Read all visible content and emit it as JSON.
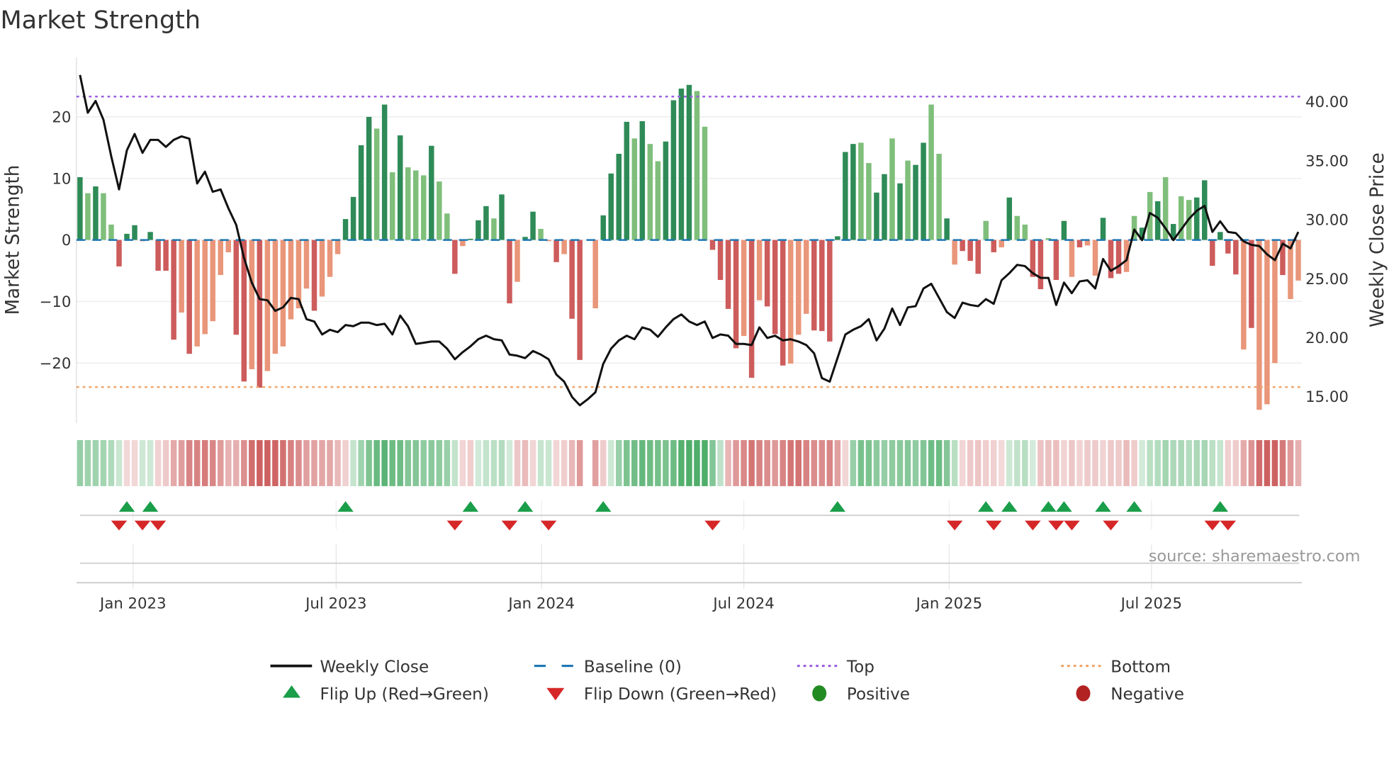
{
  "chart_data": {
    "type": "bar+line",
    "title": "Market Strength",
    "ylabel": "Market Strength",
    "y2label": "Weekly Close Price",
    "ylim": [
      -29,
      28
    ],
    "y2lim": [
      12.5,
      44.5
    ],
    "yticks": [
      20,
      10,
      0,
      -10,
      -20
    ],
    "yticklabels": [
      "20",
      "10",
      "0",
      "−10",
      "−20"
    ],
    "y2ticks": [
      40,
      35,
      30,
      25,
      20,
      15
    ],
    "y2ticklabels": [
      "40.00",
      "35.00",
      "30.00",
      "25.00",
      "20.00",
      "15.00"
    ],
    "xticks": [
      {
        "week": 6.8,
        "label": "Jan 2023"
      },
      {
        "week": 32.8,
        "label": "Jul 2023"
      },
      {
        "week": 59.1,
        "label": "Jan 2024"
      },
      {
        "week": 85.0,
        "label": "Jul 2024"
      },
      {
        "week": 111.3,
        "label": "Jan 2025"
      },
      {
        "week": 137.2,
        "label": "Jul 2025"
      }
    ],
    "top_level": 23.3,
    "bottom_level": -23.9,
    "baseline": 0,
    "strength": [
      10.2,
      7.6,
      8.7,
      7.6,
      2.5,
      -4.3,
      1,
      2.4,
      -0.2,
      1.3,
      -5,
      -5,
      -16.2,
      -11.8,
      -18.5,
      -17.3,
      -15.3,
      -13.2,
      -5.7,
      -2,
      -15.4,
      -23,
      -21,
      -24,
      -21.3,
      -18.5,
      -17.3,
      -12.9,
      -11.1,
      -7.9,
      -11.5,
      -9.2,
      -6,
      -2.3,
      3.4,
      7,
      15.4,
      20,
      18.1,
      22,
      11,
      17,
      11.8,
      11.3,
      10.5,
      15.3,
      9.5,
      4.3,
      -5.5,
      -1,
      0.2,
      3.2,
      5.5,
      3.5,
      7.4,
      -10.3,
      -6.8,
      0.5,
      4.6,
      1.8,
      -0.2,
      -3.6,
      -2.3,
      -12.8,
      -19.5,
      0,
      -11.1,
      4,
      10.8,
      14,
      19.2,
      16.5,
      19.3,
      15.6,
      12.8,
      16,
      22.7,
      24.6,
      25.2,
      24.2,
      18.4,
      -1.6,
      -6.5,
      -11.2,
      -17.6,
      -15.6,
      -22.4,
      -9.8,
      -10.8,
      -15.3,
      -20.4,
      -20.1,
      -15.4,
      -12,
      -14.7,
      -14.8,
      -16.5,
      0.6,
      14.3,
      15.6,
      15.8,
      12.5,
      7.7,
      10.7,
      16.5,
      9.2,
      12.9,
      12.2,
      15.8,
      22,
      14,
      3.5,
      -4,
      -1.8,
      -3.4,
      -5.5,
      3.1,
      -2,
      -1.2,
      6.9,
      3.9,
      2.5,
      -6,
      -8,
      0.3,
      -6.5,
      3.1,
      -6,
      -1.2,
      -0.9,
      -5.8,
      3.6,
      -6.2,
      -5.5,
      -5.2,
      3.9,
      2,
      7.8,
      6.3,
      10.2,
      2.6,
      7.1,
      6.5,
      6.9,
      9.7,
      -4.2,
      1.3,
      -2.2,
      -5.6,
      -17.8,
      -14.3,
      -27.6,
      -26.7,
      -20,
      -5.7,
      -9.6,
      -6.6
    ],
    "shade": "DLDLLDDDLDDDDLDLLLLLDDLDLLLLLLDLLLDDDDLDLDLLLDLLDLDDDLDDLDDLLDLDDLLDDDDLDLLDDDDLLDDDDLDLDDDLLLDDDDDDLLDDLDLDDLLDLDDDLDLDLLDDLDDLDLLDDDLLDLDLDLLDDDDDDLDLLLDL",
    "weekly_close": [
      42.2,
      39.0,
      40.0,
      38.4,
      35.3,
      32.5,
      35.8,
      37.2,
      35.6,
      36.7,
      36.7,
      36.1,
      36.7,
      37.0,
      36.8,
      33.0,
      34.0,
      32.3,
      32.5,
      30.9,
      29.5,
      26.7,
      24.6,
      23.2,
      23.1,
      22.2,
      22.5,
      23.3,
      23.2,
      21.5,
      21.3,
      20.2,
      20.6,
      20.4,
      21.0,
      20.9,
      21.2,
      21.2,
      21.0,
      21.1,
      20.2,
      21.8,
      20.9,
      19.4,
      19.5,
      19.6,
      19.6,
      19.0,
      18.1,
      18.7,
      19.2,
      19.8,
      20.1,
      19.8,
      19.7,
      18.5,
      18.4,
      18.2,
      18.8,
      18.5,
      18.1,
      16.8,
      16.2,
      14.9,
      14.2,
      14.7,
      15.3,
      17.7,
      19.0,
      19.7,
      20.1,
      19.8,
      20.8,
      20.6,
      20.0,
      20.8,
      21.5,
      21.9,
      21.3,
      21.0,
      21.3,
      19.9,
      20.2,
      20.1,
      19.4,
      19.4,
      19.3,
      20.8,
      19.9,
      20.1,
      19.7,
      19.8,
      19.6,
      19.3,
      18.6,
      16.5,
      16.2,
      18.2,
      20.2,
      20.6,
      20.9,
      21.5,
      19.7,
      20.7,
      22.4,
      21.0,
      22.5,
      22.6,
      24.1,
      24.5,
      23.3,
      22.1,
      21.6,
      22.9,
      22.7,
      22.6,
      23.2,
      22.8,
      24.8,
      25.4,
      26.1,
      26.0,
      25.4,
      25.0,
      25.0,
      22.7,
      24.6,
      23.7,
      24.7,
      24.8,
      24.1,
      26.6,
      25.6,
      26.0,
      26.5,
      29.1,
      28.2,
      30.5,
      30.1,
      29.2,
      28.2,
      29.1,
      30.0,
      30.7,
      31.1,
      28.9,
      29.8,
      28.9,
      28.8,
      28.1,
      27.8,
      27.7,
      27.0,
      26.5,
      27.9,
      27.5,
      28.9
    ],
    "flip_up_weeks": [
      6,
      9,
      34,
      50,
      57,
      67,
      97,
      116,
      119,
      124,
      126,
      131,
      135,
      146
    ],
    "flip_down_weeks": [
      5,
      8,
      10,
      48,
      55,
      60,
      81,
      112,
      117,
      122,
      125,
      127,
      132,
      145,
      147
    ],
    "legend": {
      "placement": "bottom",
      "items": [
        {
          "label": "Weekly Close",
          "symbol": "line"
        },
        {
          "label": "Baseline (0)",
          "symbol": "dash"
        },
        {
          "label": "Top",
          "symbol": "dot-purple"
        },
        {
          "label": "Bottom",
          "symbol": "dot-orange"
        },
        {
          "label": "Flip Up (Red→Green)",
          "symbol": "triangle-up"
        },
        {
          "label": "Flip Down (Green→Red)",
          "symbol": "triangle-down"
        },
        {
          "label": "Positive",
          "symbol": "circle-green"
        },
        {
          "label": "Negative",
          "symbol": "circle-red"
        }
      ]
    }
  },
  "source": "source: sharemaestro.com",
  "colors": {
    "pos_strong": "#2e8b57",
    "pos_light": "#7fbf7b",
    "neg_strong": "#cd5c5c",
    "neg_light": "#e9967a",
    "top": "#9b5fe0",
    "bottom": "#f0a468",
    "baseline": "#1f77b4",
    "line": "#111111",
    "flip_up": "#1a9e4a",
    "flip_down": "#d62728",
    "positive": "#228b22",
    "negative": "#b22222"
  }
}
